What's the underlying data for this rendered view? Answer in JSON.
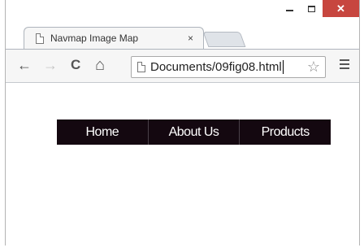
{
  "window": {
    "controls": {
      "minimize": "",
      "maximize": "",
      "close": "✕"
    }
  },
  "tab": {
    "title": "Navmap Image Map",
    "close_glyph": "×"
  },
  "toolbar": {
    "back": "←",
    "forward": "→",
    "reload": "C",
    "home": "⌂",
    "url": "Documents/09fig08.html",
    "star": "☆"
  },
  "page": {
    "nav_items": [
      {
        "label": "Home"
      },
      {
        "label": "About Us"
      },
      {
        "label": "Products"
      }
    ],
    "nav_bg_color": "#140810",
    "nav_text_color": "#ffffff"
  }
}
